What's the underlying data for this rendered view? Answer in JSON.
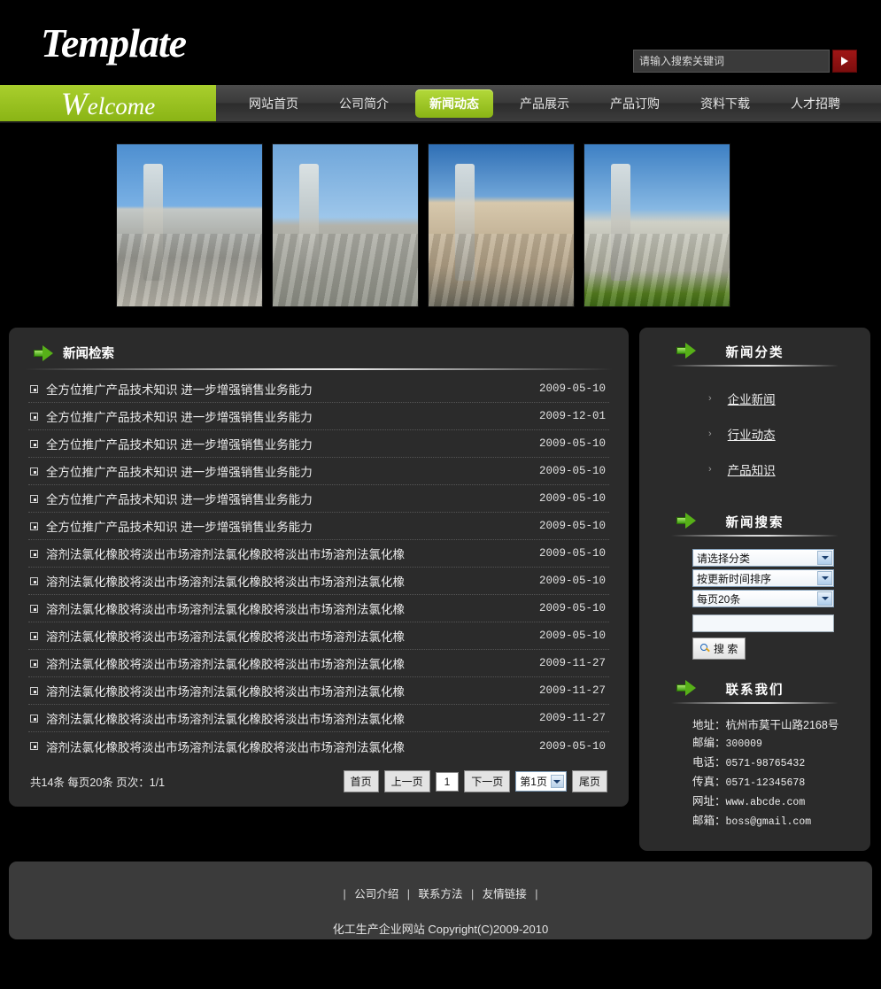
{
  "header": {
    "logo": "Template",
    "search": {
      "placeholder": "请输入搜索关键词",
      "value": "",
      "submit_icon": "play-triangle-icon"
    }
  },
  "nav": {
    "welcome": "Welcome",
    "welcome_cap": "W",
    "welcome_rest": "elcome",
    "items": [
      {
        "label": "网站首页",
        "active": false
      },
      {
        "label": "公司简介",
        "active": false
      },
      {
        "label": "新闻动态",
        "active": true
      },
      {
        "label": "产品展示",
        "active": false
      },
      {
        "label": "产品订购",
        "active": false
      },
      {
        "label": "资料下载",
        "active": false
      },
      {
        "label": "人才招聘",
        "active": false
      }
    ]
  },
  "banner": {
    "images": [
      "industrial-conveyor-photo",
      "refinery-tower-photo",
      "chemical-plant-pipes-photo",
      "storage-tanks-photo"
    ]
  },
  "main": {
    "section_title": "新闻检索",
    "section_icon": "green-arrow-icon",
    "news": [
      {
        "title": "全方位推广产品技术知识 进一步增强销售业务能力",
        "date": "2009-05-10"
      },
      {
        "title": "全方位推广产品技术知识 进一步增强销售业务能力",
        "date": "2009-12-01"
      },
      {
        "title": "全方位推广产品技术知识 进一步增强销售业务能力",
        "date": "2009-05-10"
      },
      {
        "title": "全方位推广产品技术知识 进一步增强销售业务能力",
        "date": "2009-05-10"
      },
      {
        "title": "全方位推广产品技术知识 进一步增强销售业务能力",
        "date": "2009-05-10"
      },
      {
        "title": "全方位推广产品技术知识 进一步增强销售业务能力",
        "date": "2009-05-10"
      },
      {
        "title": "溶剂法氯化橡胶将淡出市场溶剂法氯化橡胶将淡出市场溶剂法氯化橡",
        "date": "2009-05-10"
      },
      {
        "title": "溶剂法氯化橡胶将淡出市场溶剂法氯化橡胶将淡出市场溶剂法氯化橡",
        "date": "2009-05-10"
      },
      {
        "title": "溶剂法氯化橡胶将淡出市场溶剂法氯化橡胶将淡出市场溶剂法氯化橡",
        "date": "2009-05-10"
      },
      {
        "title": "溶剂法氯化橡胶将淡出市场溶剂法氯化橡胶将淡出市场溶剂法氯化橡",
        "date": "2009-05-10"
      },
      {
        "title": "溶剂法氯化橡胶将淡出市场溶剂法氯化橡胶将淡出市场溶剂法氯化橡",
        "date": "2009-11-27"
      },
      {
        "title": "溶剂法氯化橡胶将淡出市场溶剂法氯化橡胶将淡出市场溶剂法氯化橡",
        "date": "2009-11-27"
      },
      {
        "title": "溶剂法氯化橡胶将淡出市场溶剂法氯化橡胶将淡出市场溶剂法氯化橡",
        "date": "2009-11-27"
      },
      {
        "title": "溶剂法氯化橡胶将淡出市场溶剂法氯化橡胶将淡出市场溶剂法氯化橡",
        "date": "2009-05-10"
      }
    ],
    "pager": {
      "info": "共14条 每页20条 页次：1/1",
      "first": "首页",
      "prev": "上一页",
      "current": "1",
      "next": "下一页",
      "page_select": "第1页",
      "last": "尾页"
    }
  },
  "sidebar": {
    "categories": {
      "title": "新闻分类",
      "icon": "green-arrow-icon",
      "items": [
        {
          "label": "企业新闻"
        },
        {
          "label": "行业动态"
        },
        {
          "label": "产品知识"
        }
      ]
    },
    "search": {
      "title": "新闻搜索",
      "icon": "green-arrow-icon",
      "category_select": "请选择分类",
      "sort_select": "按更新时间排序",
      "perpage_select": "每页20条",
      "keyword_value": "",
      "button_label": "搜 索",
      "button_icon": "magnifier-icon"
    },
    "contact": {
      "title": "联系我们",
      "icon": "green-arrow-icon",
      "lines": [
        {
          "label": "地址：",
          "value": "杭州市莫干山路2168号"
        },
        {
          "label": "邮编：",
          "value": "300009"
        },
        {
          "label": "电话：",
          "value": "0571-98765432"
        },
        {
          "label": "传真：",
          "value": "0571-12345678"
        },
        {
          "label": "网址：",
          "value": "www.abcde.com"
        },
        {
          "label": "邮箱：",
          "value": "boss@gmail.com"
        }
      ]
    }
  },
  "footer": {
    "links": [
      {
        "label": "公司介绍"
      },
      {
        "label": "联系方法"
      },
      {
        "label": "友情链接"
      }
    ],
    "copyright": "化工生产企业网站 Copyright(C)2009-2010"
  },
  "colors": {
    "page_bg": "#000000",
    "panel_bg": "#2b2b2b",
    "accent_green": "#8ab415",
    "accent_green_light": "#b3d93a",
    "search_btn_red": "#a01616",
    "footer_bg": "#3b3b3b"
  }
}
